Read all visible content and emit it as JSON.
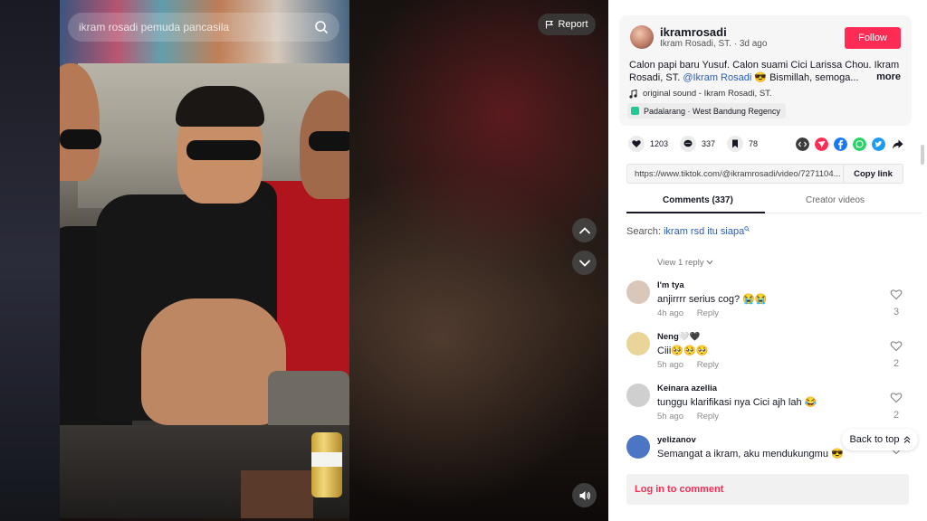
{
  "video": {
    "search_text": "ikram rosadi pemuda pancasila",
    "report_label": "Report"
  },
  "post": {
    "username": "ikramrosadi",
    "display_name": "Ikram Rosadi, ST.",
    "time_ago": "3d ago",
    "follow_label": "Follow",
    "caption_before": "Calon papi baru Yusuf. Calon suami Cici Larissa Chou. Ikram Rosadi, ST. ",
    "caption_mention": "@Ikram Rosadi",
    "caption_after": " 😎 Bismillah, semoga...",
    "more_label": "more",
    "sound": "original sound - Ikram Rosadi, ST.",
    "location": "Padalarang · West Bandung Regency"
  },
  "stats": {
    "likes": "1203",
    "comments": "337",
    "saves": "78"
  },
  "share": {
    "url": "https://www.tiktok.com/@ikramrosadi/video/7271104...",
    "copy_label": "Copy link",
    "colors": [
      "#3d3d3d",
      "#fe2c55",
      "#1877f2",
      "#25d366",
      "#1d9bf0"
    ]
  },
  "tabs": {
    "comments": "Comments (337)",
    "creator": "Creator videos"
  },
  "search_comments": {
    "prefix": "Search: ",
    "term": "ikram rsd itu siapa"
  },
  "view_reply": "View 1 reply",
  "comments": [
    {
      "name": "I'm tya",
      "text": "anjirrrr serius cog? 😭😭",
      "time": "4h ago",
      "reply": "Reply",
      "likes": "3",
      "avatar": "#d9c7b9"
    },
    {
      "name": "Neng🤍🖤",
      "text": "Ciii🥺🥺🥺",
      "time": "5h ago",
      "reply": "Reply",
      "likes": "2",
      "avatar": "#e9d59a"
    },
    {
      "name": "Keinara azellia",
      "text": "tunggu klarifikasi nya Cici ajh lah 😂",
      "time": "5h ago",
      "reply": "Reply",
      "likes": "2",
      "avatar": "#cfcfcf"
    },
    {
      "name": "yelizanov",
      "text": "Semangat a ikram, aku mendukungmu 😎",
      "time": "",
      "reply": "",
      "likes": "",
      "avatar": "#4c76c4"
    }
  ],
  "back_to_top": "Back to top",
  "login_label": "Log in to comment"
}
